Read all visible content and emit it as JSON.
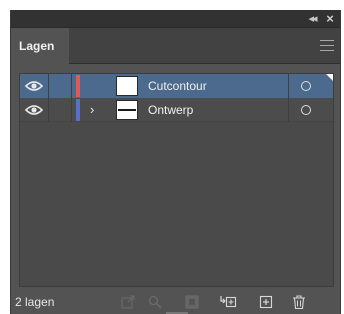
{
  "panel": {
    "tab_label": "Lagen",
    "layers": [
      {
        "name": "Cutcontour",
        "color": "#e05858",
        "selected": true,
        "expandable": false
      },
      {
        "name": "Ontwerp",
        "color": "#5a6fc7",
        "selected": false,
        "expandable": true
      }
    ],
    "footer": {
      "layer_count": "2 lagen"
    }
  },
  "icons": {
    "collapse": "double-chevron-left-icon",
    "close": "close-icon",
    "menu": "hamburger-menu-icon",
    "visibility": "eye-icon",
    "expand": "chevron-right-icon",
    "target": "target-circle-icon",
    "footer_buttons": [
      "export-icon",
      "search-icon",
      "clipping-mask-icon",
      "new-sublayer-icon",
      "new-layer-icon",
      "trash-icon"
    ]
  }
}
